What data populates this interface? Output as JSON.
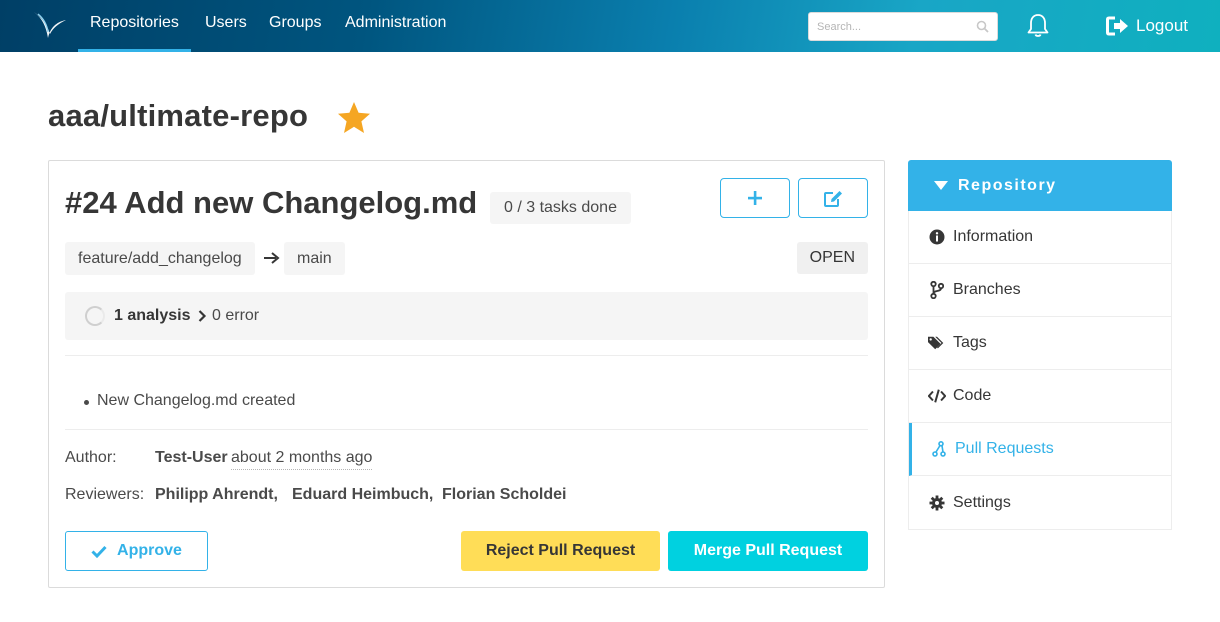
{
  "navbar": {
    "items": [
      {
        "label": "Repositories",
        "active": true
      },
      {
        "label": "Users"
      },
      {
        "label": "Groups"
      },
      {
        "label": "Administration"
      }
    ],
    "search_placeholder": "Search...",
    "logout_label": "Logout"
  },
  "repo": {
    "title": "aaa/ultimate-repo",
    "starred": true
  },
  "pull_request": {
    "title": "#24 Add new Changelog.md",
    "tasks": "0 / 3 tasks done",
    "source_branch": "feature/add_changelog",
    "target_branch": "main",
    "status": "OPEN",
    "analysis": {
      "count_label": "1 analysis",
      "error_label": "0 error"
    },
    "description_items": [
      "New Changelog.md created"
    ],
    "author_label": "Author:",
    "author": "Test-User",
    "time": "about 2 months ago",
    "reviewers_label": "Reviewers:",
    "reviewers": [
      "Philipp Ahrendt,",
      "Eduard Heimbuch,",
      "Florian Scholdei"
    ],
    "buttons": {
      "approve": "Approve",
      "reject": "Reject Pull Request",
      "merge": "Merge Pull Request"
    }
  },
  "sidebar": {
    "heading": "Repository",
    "items": [
      {
        "label": "Information",
        "icon": "info-circle-icon"
      },
      {
        "label": "Branches",
        "icon": "code-branch-icon"
      },
      {
        "label": "Tags",
        "icon": "tags-icon"
      },
      {
        "label": "Code",
        "icon": "code-icon"
      },
      {
        "label": "Pull Requests",
        "icon": "pull-request-icon",
        "active": true
      },
      {
        "label": "Settings",
        "icon": "cog-icon"
      }
    ]
  },
  "colors": {
    "primary": "#33b2e8",
    "warning": "#ffdd57",
    "merge": "#00d1e0",
    "star": "#f5a623"
  }
}
